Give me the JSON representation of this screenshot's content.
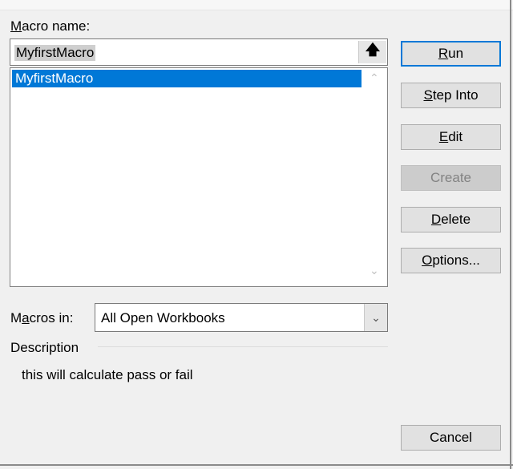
{
  "macro_name_label": "Macro name:",
  "macro_name_value": "MyfirstMacro",
  "upload_icon": "up-arrow-icon",
  "macro_list": [
    {
      "name": "MyfirstMacro",
      "selected": true
    }
  ],
  "buttons": {
    "run": "Run",
    "step_into": "Step Into",
    "edit": "Edit",
    "create": "Create",
    "delete": "Delete",
    "options": "Options...",
    "cancel": "Cancel"
  },
  "macros_in": {
    "label_parts": [
      "M",
      "a",
      "cros in:"
    ],
    "value": "All Open Workbooks"
  },
  "description": {
    "label": "Description",
    "text": "this will calculate pass or fail"
  },
  "colors": {
    "accent": "#0078d7",
    "dialog_bg": "#f0f0f0"
  }
}
